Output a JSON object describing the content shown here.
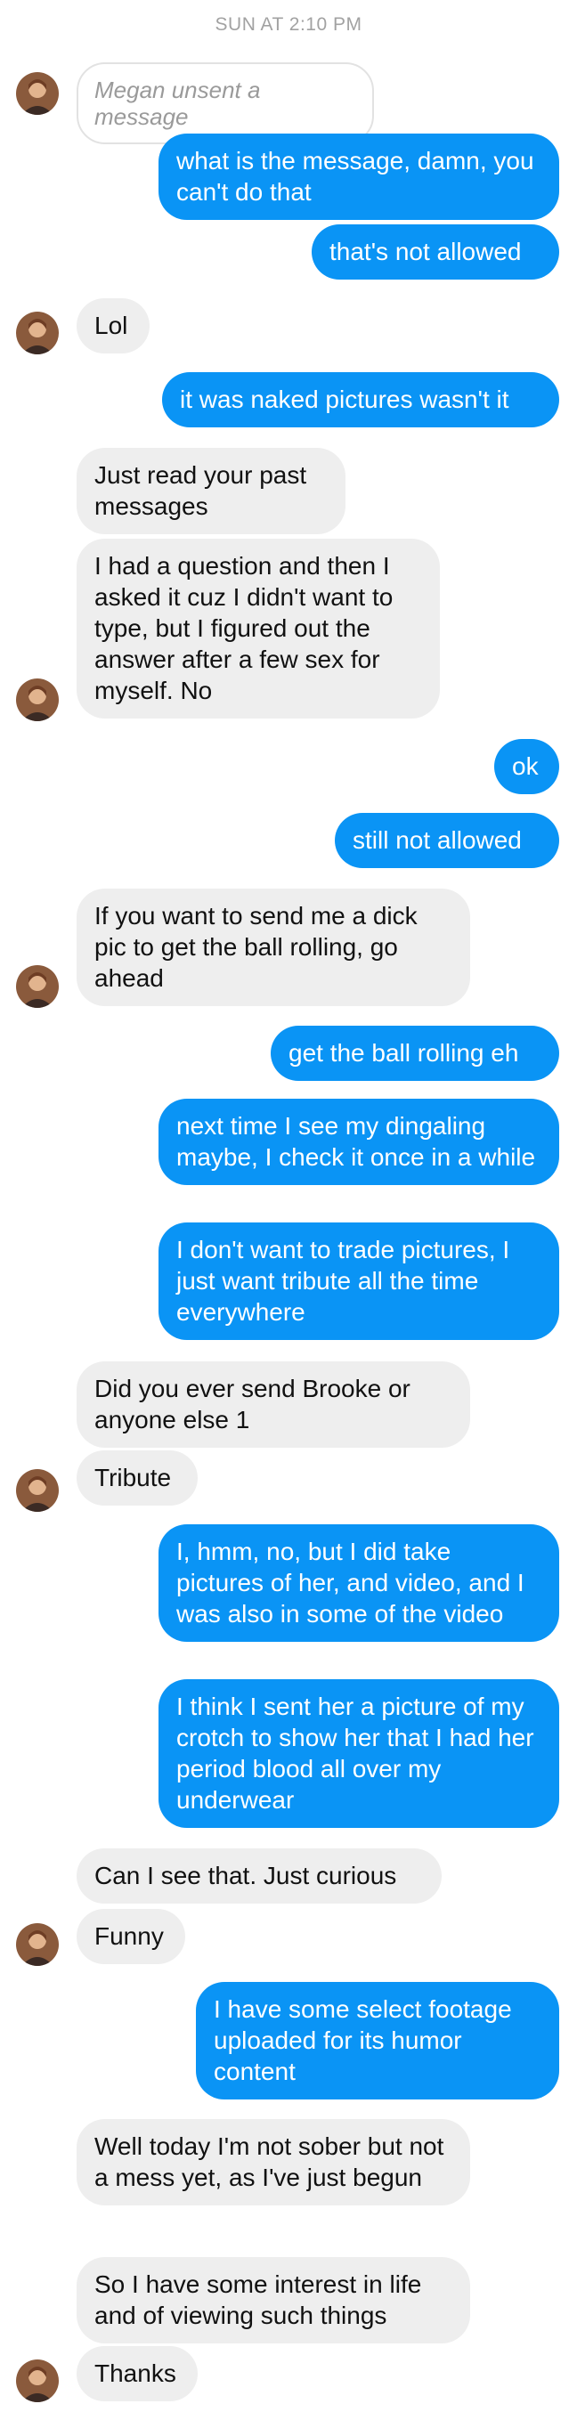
{
  "header": {
    "timestamp": "SUN AT 2:10 PM"
  },
  "contact": {
    "avatar_icon": "profile-photo"
  },
  "messages": [
    {
      "from": "them",
      "type": "unsent",
      "text": "Megan unsent a message"
    },
    {
      "from": "me",
      "text": "what is the message, damn, you can't do that"
    },
    {
      "from": "me",
      "text": "that's not allowed"
    },
    {
      "from": "them",
      "text": "Lol"
    },
    {
      "from": "me",
      "text": "it was naked pictures wasn't it"
    },
    {
      "from": "them",
      "text": "Just read your past messages"
    },
    {
      "from": "them",
      "text": "I had a question and then I asked it cuz I didn't want to type, but I figured out the answer after a few sex for myself. No"
    },
    {
      "from": "me",
      "text": "ok"
    },
    {
      "from": "me",
      "text": "still not allowed"
    },
    {
      "from": "them",
      "text": "If you want to send me a dick pic to get the ball rolling, go ahead"
    },
    {
      "from": "me",
      "text": "get the ball rolling eh"
    },
    {
      "from": "me",
      "text": "next time I see my dingaling maybe, I check it once in a while"
    },
    {
      "from": "me",
      "text": "I don't want to trade pictures, I just want tribute all the time everywhere"
    },
    {
      "from": "them",
      "text": "Did you ever send Brooke or anyone else 1"
    },
    {
      "from": "them",
      "text": "Tribute"
    },
    {
      "from": "me",
      "text": "I, hmm, no, but I did take pictures of her, and video, and I was also in some of the video"
    },
    {
      "from": "me",
      "text": "I think I sent her a picture of my crotch to show her that I had her period blood all over my underwear"
    },
    {
      "from": "them",
      "text": "Can I see that. Just curious"
    },
    {
      "from": "them",
      "text": "Funny"
    },
    {
      "from": "me",
      "text": "I have some select footage uploaded for its humor content"
    },
    {
      "from": "them",
      "text": "Well today I'm not sober but not a mess yet, as I've just begun"
    },
    {
      "from": "them",
      "text": "So I have some interest in life and of viewing such things"
    },
    {
      "from": "them",
      "text": "Thanks"
    }
  ],
  "colors": {
    "outgoing_bubble": "#0a94f5",
    "incoming_bubble": "#eeeeee",
    "timestamp_text": "#a2a2a2"
  }
}
